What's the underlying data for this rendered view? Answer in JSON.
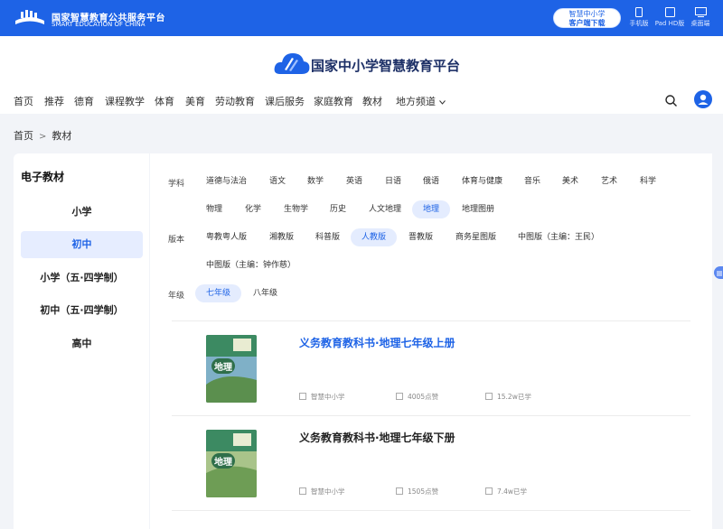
{
  "topbar": {
    "title": "国家智慧教育公共服务平台",
    "subtitle": "SMART EDUCATION OF CHINA",
    "download": {
      "line1": "智慧中小学",
      "line2": "客户端下载"
    },
    "devices": [
      "手机版",
      "Pad HD版",
      "桌面端"
    ]
  },
  "header": {
    "brand": "国家中小学智慧教育平台",
    "nav": [
      "首页",
      "推荐",
      "德育",
      "课程教学",
      "体育",
      "美育",
      "劳动教育",
      "课后服务",
      "家庭教育",
      "教材",
      "地方频道"
    ]
  },
  "breadcrumb": {
    "home": "首页",
    "separator": ">",
    "current": "教材"
  },
  "sidebar": {
    "title": "电子教材",
    "items": [
      "小学",
      "初中",
      "小学（五·四学制）",
      "初中（五·四学制）",
      "高中"
    ],
    "active_index": 1
  },
  "filters": {
    "subject_label": "学科",
    "subjects": [
      "道德与法治",
      "语文",
      "数学",
      "英语",
      "日语",
      "俄语",
      "体育与健康",
      "音乐",
      "美术",
      "艺术",
      "科学",
      "物理",
      "化学",
      "生物学",
      "历史",
      "人文地理",
      "地理",
      "地理图册"
    ],
    "subject_selected": "地理",
    "edition_label": "版本",
    "editions": [
      "粤教粤人版",
      "湘教版",
      "科普版",
      "人教版",
      "晋教版",
      "商务星图版",
      "中图版（主编：王民）",
      "中图版（主编：钟作慈）"
    ],
    "edition_selected": "人教版",
    "grade_label": "年级",
    "grades": [
      "七年级",
      "八年级"
    ],
    "grade_selected": "七年级"
  },
  "books": [
    {
      "title": "义务教育教科书·地理七年级上册",
      "cover_text": "地理",
      "source": "智慧中小学",
      "likes": "4005点赞",
      "learners": "15.2w已学",
      "highlighted": true
    },
    {
      "title": "义务教育教科书·地理七年级下册",
      "cover_text": "地理",
      "source": "智慧中小学",
      "likes": "1505点赞",
      "learners": "7.4w已学",
      "highlighted": false
    }
  ],
  "colors": {
    "primary": "#1e63e6",
    "selected_bg": "#e4ecfe",
    "brand_text": "#1c2f66"
  }
}
